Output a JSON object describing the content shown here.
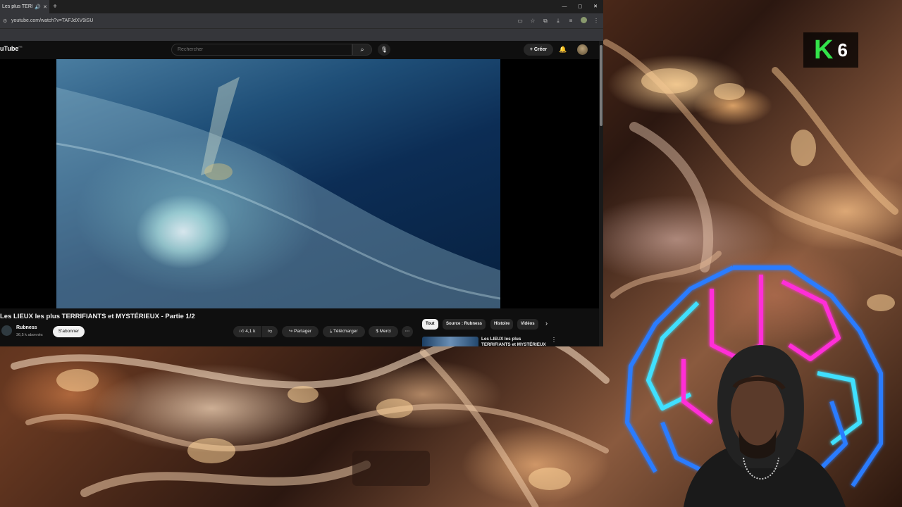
{
  "browser": {
    "tab_title": "Les plus TERRIFIA",
    "tab_audio_icon": "speaker-icon",
    "url": "youtube.com/watch?v=TAFJdXV9iSU"
  },
  "youtube": {
    "logo_text": "uTube",
    "logo_region": "FR",
    "search_placeholder": "Rechercher",
    "create_label": "Créer",
    "video_title": "Les LIEUX les plus TERRIFIANTS et MYSTÉRIEUX - Partie 1/2",
    "channel_name": "Rubness",
    "channel_subscribers": "36,5 k abonnés",
    "subscribe_label": "S'abonner",
    "like_count": "4,1 k",
    "share_label": "Partager",
    "download_label": "Télécharger",
    "thanks_label": "Merci",
    "chips": [
      "Tout",
      "Source : Rubness",
      "Histoire",
      "Vidéos"
    ],
    "recommended_title": "Les LIEUX les plus TERRIFIANTS et MYSTÉRIEUX"
  },
  "overlay": {
    "badge_letter": "K",
    "badge_number": "6"
  },
  "colors": {
    "badge_green": "#33e34a",
    "youtube_bg": "#0f0f0f",
    "neon_pink": "#ff2fd8",
    "neon_blue": "#2a7bff",
    "neon_cyan": "#3fe0ff"
  }
}
